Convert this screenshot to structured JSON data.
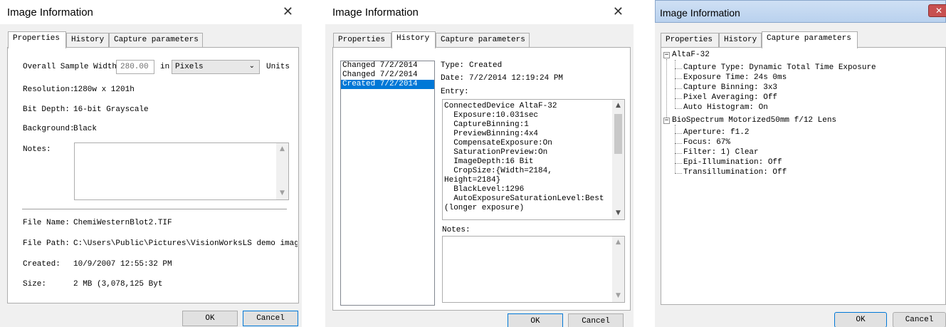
{
  "dialog_title": "Image Information",
  "close_glyph": "✕",
  "tabs": {
    "properties": "Properties",
    "history": "History",
    "capture": "Capture parameters"
  },
  "buttons": {
    "ok": "OK",
    "cancel": "Cancel"
  },
  "properties": {
    "sample_width_label": "Overall Sample Width:",
    "sample_width_value": "280.00",
    "in_label": "in",
    "units_value": "Pixels",
    "units_label": "Units",
    "resolution_label": "Resolution:",
    "resolution_value": "1280w x 1201h",
    "bitdepth_label": "Bit Depth:",
    "bitdepth_value": "16-bit Grayscale",
    "background_label": "Background:",
    "background_value": "Black",
    "notes_label": "Notes:",
    "filename_label": "File Name:",
    "filename_value": "ChemiWesternBlot2.TIF",
    "filepath_label": "File Path:",
    "filepath_value": "C:\\Users\\Public\\Pictures\\VisionWorksLS demo images",
    "created_label": "Created:",
    "created_value": "10/9/2007 12:55:32 PM",
    "size_label": "Size:",
    "size_value": "2 MB (3,078,125 Byt"
  },
  "history": {
    "items": [
      "Changed 7/2/2014",
      "Changed 7/2/2014",
      "Created 7/2/2014"
    ],
    "selected_index": 2,
    "type_label": "Type:",
    "type_value": "Created",
    "date_label": "Date:",
    "date_value": "7/2/2014 12:19:24 PM",
    "entry_label": "Entry:",
    "entry_lines": [
      "ConnectedDevice AltaF-32",
      "  Exposure:10.031sec",
      "  CaptureBinning:1",
      "  PreviewBinning:4x4",
      "  CompensateExposure:On",
      "  SaturationPreview:On",
      "  ImageDepth:16 Bit",
      "  CropSize:{Width=2184,",
      "Height=2184}",
      "  BlackLevel:1296",
      "  AutoExposureSaturationLevel:Best",
      "(longer exposure)"
    ],
    "notes_label": "Notes:"
  },
  "capture": {
    "nodes": [
      {
        "label": "AltaF-32",
        "children": [
          "Capture Type: Dynamic Total Time Exposure",
          "Exposure Time: 24s 0ms",
          "Capture Binning: 3x3",
          "Pixel Averaging: Off",
          "Auto Histogram: On"
        ]
      },
      {
        "label": "BioSpectrum Motorized50mm f/12 Lens",
        "children": [
          "Aperture: f1.2",
          "Focus: 67%",
          "Filter: 1) Clear",
          "Epi-Illumination: Off",
          "Transillumination: Off"
        ]
      }
    ]
  }
}
